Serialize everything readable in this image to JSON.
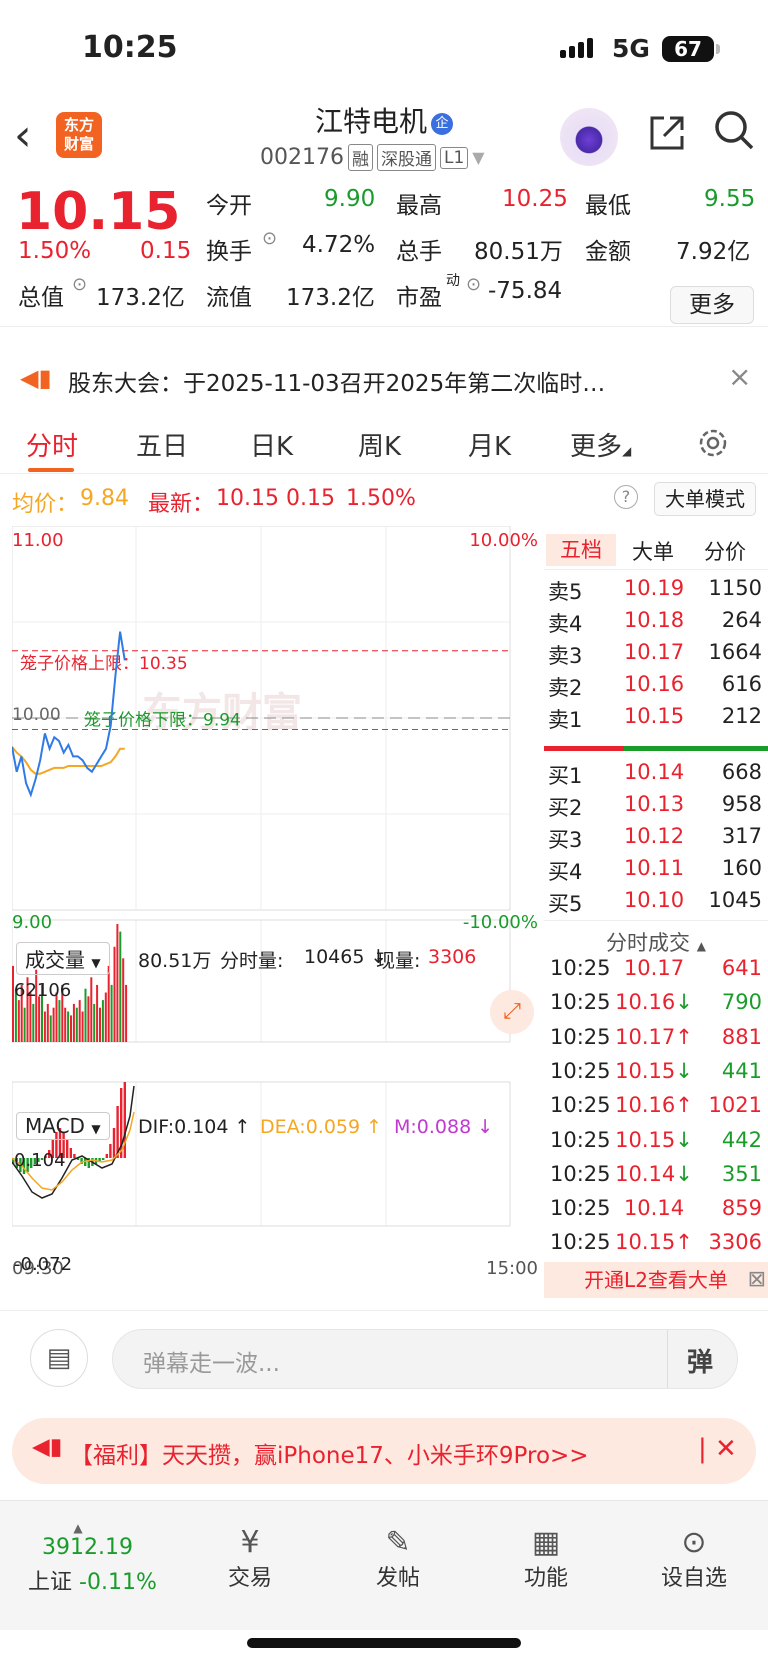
{
  "status": {
    "time": "10:25",
    "network": "5G",
    "battery": "67"
  },
  "nav": {
    "title": "江特电机",
    "badge": "企",
    "code": "002176",
    "tags": [
      "融",
      "深股通",
      "L1"
    ]
  },
  "quote": {
    "price": "10.15",
    "pct": "1.50%",
    "chg": "0.15",
    "open_label": "今开",
    "open": "9.90",
    "high_label": "最高",
    "high": "10.25",
    "low_label": "最低",
    "low": "9.55",
    "turnover_label": "换手",
    "turnover": "4.72%",
    "vol_label": "总手",
    "vol": "80.51万",
    "amount_label": "金额",
    "amount": "7.92亿",
    "mcap_label": "总值",
    "mcap": "173.2亿",
    "float_label": "流值",
    "float": "173.2亿",
    "pe_label": "市盈",
    "pe_sup": "动",
    "pe": "-75.84",
    "more": "更多"
  },
  "notice": {
    "text": "股东大会：于2025-11-03召开2025年第二次临时…"
  },
  "tabs": [
    "分时",
    "五日",
    "日K",
    "周K",
    "月K",
    "更多"
  ],
  "avg": {
    "avg_label": "均价：",
    "avg": "9.84",
    "latest_label": "最新：",
    "latest": "10.15",
    "chg": "0.15",
    "pct": "1.50%",
    "big_mode": "大单模式"
  },
  "chart_data": [
    {
      "type": "line",
      "title": "",
      "y_max_label": "11.00",
      "y_min_label": "9.00",
      "pct_max_label": "10.00%",
      "pct_min_label": "-10.00%",
      "ylim": [
        9.0,
        11.0
      ],
      "upper_limit_label": "笼子价格上限：10.35",
      "upper_limit": 10.35,
      "lower_limit_label": "笼子价格下限：9.94",
      "lower_limit": 9.94,
      "prev_close_label": "10.00",
      "prev_close": 10.0,
      "watermark": "东方财富",
      "series": [
        {
          "values": [
            9.85,
            9.72,
            9.8,
            9.66,
            9.6,
            9.68,
            9.78,
            9.92,
            9.84,
            9.9,
            9.88,
            9.82,
            9.86,
            9.8,
            9.8,
            9.78,
            9.74,
            9.72,
            9.76,
            9.8,
            9.84,
            9.96,
            10.22,
            10.45,
            10.3
          ]
        },
        {
          "values": [
            9.85,
            9.82,
            9.8,
            9.77,
            9.73,
            9.71,
            9.71,
            9.72,
            9.73,
            9.74,
            9.74,
            9.74,
            9.75,
            9.75,
            9.75,
            9.75,
            9.75,
            9.75,
            9.75,
            9.75,
            9.76,
            9.77,
            9.8,
            9.84,
            9.84
          ]
        }
      ]
    },
    {
      "type": "bar",
      "title": "",
      "selector": "成交量",
      "total": "80.51万",
      "fs_label": "分时量:",
      "fs_value": "10465 ↓",
      "now_label": "现量:",
      "now_value": "3306",
      "max_label": "62106",
      "values": [
        40,
        28,
        22,
        30,
        18,
        34,
        26,
        20,
        38,
        24,
        30,
        16,
        20,
        14,
        18,
        26,
        22,
        30,
        18,
        16,
        14,
        20,
        18,
        22,
        16,
        28,
        24,
        34,
        20,
        30,
        18,
        22,
        26,
        40,
        30,
        50,
        62,
        58,
        44,
        30
      ]
    },
    {
      "type": "bar",
      "title": "",
      "selector": "MACD",
      "dif_label": "DIF:0.104 ↑",
      "dea_label": "DEA:0.059 ↑",
      "m_label": "M:0.088 ↓",
      "max_label": "0.104",
      "min_label": "-0.072",
      "x_start": "09:30",
      "x_end": "15:00"
    }
  ],
  "orderbook": {
    "tabs": [
      "五档",
      "大单",
      "分价"
    ],
    "asks": [
      [
        "卖5",
        "10.19",
        "1150"
      ],
      [
        "卖4",
        "10.18",
        "264"
      ],
      [
        "卖3",
        "10.17",
        "1664"
      ],
      [
        "卖2",
        "10.16",
        "616"
      ],
      [
        "卖1",
        "10.15",
        "212"
      ]
    ],
    "bids": [
      [
        "买1",
        "10.14",
        "668"
      ],
      [
        "买2",
        "10.13",
        "958"
      ],
      [
        "买3",
        "10.12",
        "317"
      ],
      [
        "买4",
        "10.11",
        "160"
      ],
      [
        "买5",
        "10.10",
        "1045"
      ]
    ]
  },
  "ticks": {
    "title": "分时成交",
    "rows": [
      [
        "10:25",
        "10.17",
        "",
        "641"
      ],
      [
        "10:25",
        "10.16",
        "↓",
        "790"
      ],
      [
        "10:25",
        "10.17",
        "↑",
        "881"
      ],
      [
        "10:25",
        "10.15",
        "↓",
        "441"
      ],
      [
        "10:25",
        "10.16",
        "↑",
        "1021"
      ],
      [
        "10:25",
        "10.15",
        "↓",
        "442"
      ],
      [
        "10:25",
        "10.14",
        "↓",
        "351"
      ],
      [
        "10:25",
        "10.14",
        "",
        "859"
      ],
      [
        "10:25",
        "10.15",
        "↑",
        "3306"
      ]
    ],
    "l2": "开通L2查看大单"
  },
  "comment": {
    "placeholder": "弹幕走一波...",
    "btn": "弹"
  },
  "promo": {
    "text": "【福利】天天攒，赢iPhone17、小米手环9Pro>>"
  },
  "dock": {
    "index_value": "3912.19",
    "index_name": "上证",
    "index_pct": "-0.11%",
    "items": [
      "交易",
      "发帖",
      "功能",
      "设自选"
    ]
  }
}
